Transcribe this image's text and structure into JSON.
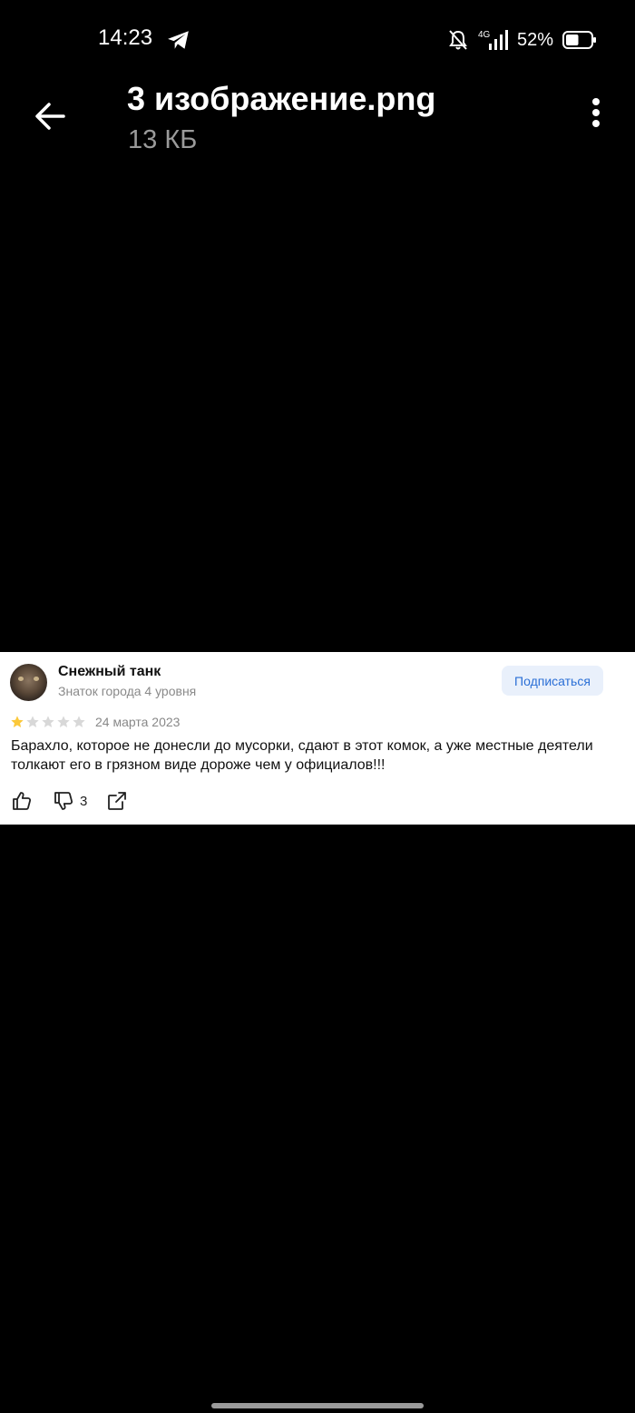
{
  "status_bar": {
    "time": "14:23",
    "network": "4G",
    "battery": "52%",
    "battery_level": 0.52,
    "icons": [
      "telegram-icon",
      "bell-off-icon",
      "signal-icon",
      "battery-icon"
    ]
  },
  "header": {
    "file_name": "3 изображение.png",
    "file_size": "13 КБ",
    "icons": [
      "back-arrow-icon",
      "more-vertical-icon"
    ]
  },
  "review": {
    "author": "Снежный танк",
    "level": "Знаток города 4 уровня",
    "subscribe_label": "Подписаться",
    "rating": 1,
    "rating_max": 5,
    "date": "24 марта 2023",
    "text": "Барахло, которое не донесли до мусорки, сдают в этот комок, а уже местные деятели толкают его в грязном виде дороже чем у официалов!!!",
    "dislike_count": "3",
    "colors": {
      "star_active": "#fbc83a",
      "star_inactive": "#d8d8d8",
      "subscribe_text": "#2b6fd6",
      "subscribe_bg": "#e9f0fb"
    }
  },
  "colors": {
    "background": "#000000",
    "card": "#ffffff",
    "muted": "#9a9a9a"
  }
}
